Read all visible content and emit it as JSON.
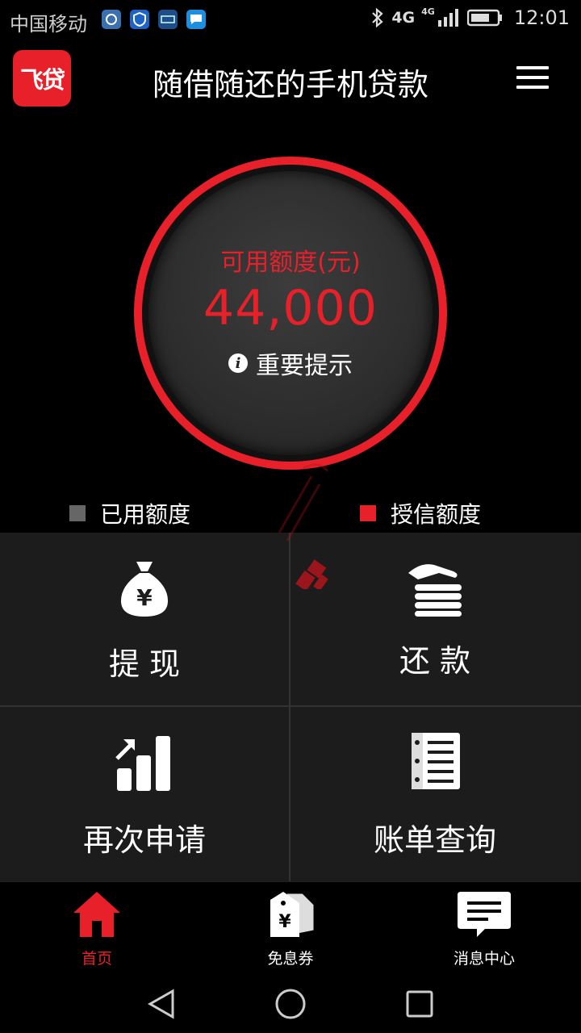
{
  "status_bar": {
    "carrier": "中国移动",
    "network": "4G",
    "network2": "4G",
    "time": "12:01"
  },
  "header": {
    "logo_text": "飞贷",
    "title": "随借随还的手机贷款"
  },
  "credit": {
    "label": "可用额度(元)",
    "amount": "44,000",
    "notice": "重要提示"
  },
  "legend": {
    "used": {
      "label": "已用额度",
      "color": "#666666"
    },
    "granted": {
      "label": "授信额度",
      "color": "#e8202a"
    }
  },
  "actions": [
    {
      "label": "提 现",
      "icon": "money-bag-icon"
    },
    {
      "label": "还 款",
      "icon": "coin-stack-icon"
    },
    {
      "label": "再次申请",
      "icon": "bar-chart-icon"
    },
    {
      "label": "账单查询",
      "icon": "notebook-icon"
    }
  ],
  "bottom_nav": [
    {
      "label": "首页",
      "icon": "home-icon",
      "active": true
    },
    {
      "label": "免息券",
      "icon": "coupon-tag-icon",
      "active": false
    },
    {
      "label": "消息中心",
      "icon": "message-icon",
      "active": false
    }
  ],
  "colors": {
    "accent": "#e8202a",
    "background": "#000000",
    "grid": "#1c1c1c"
  }
}
